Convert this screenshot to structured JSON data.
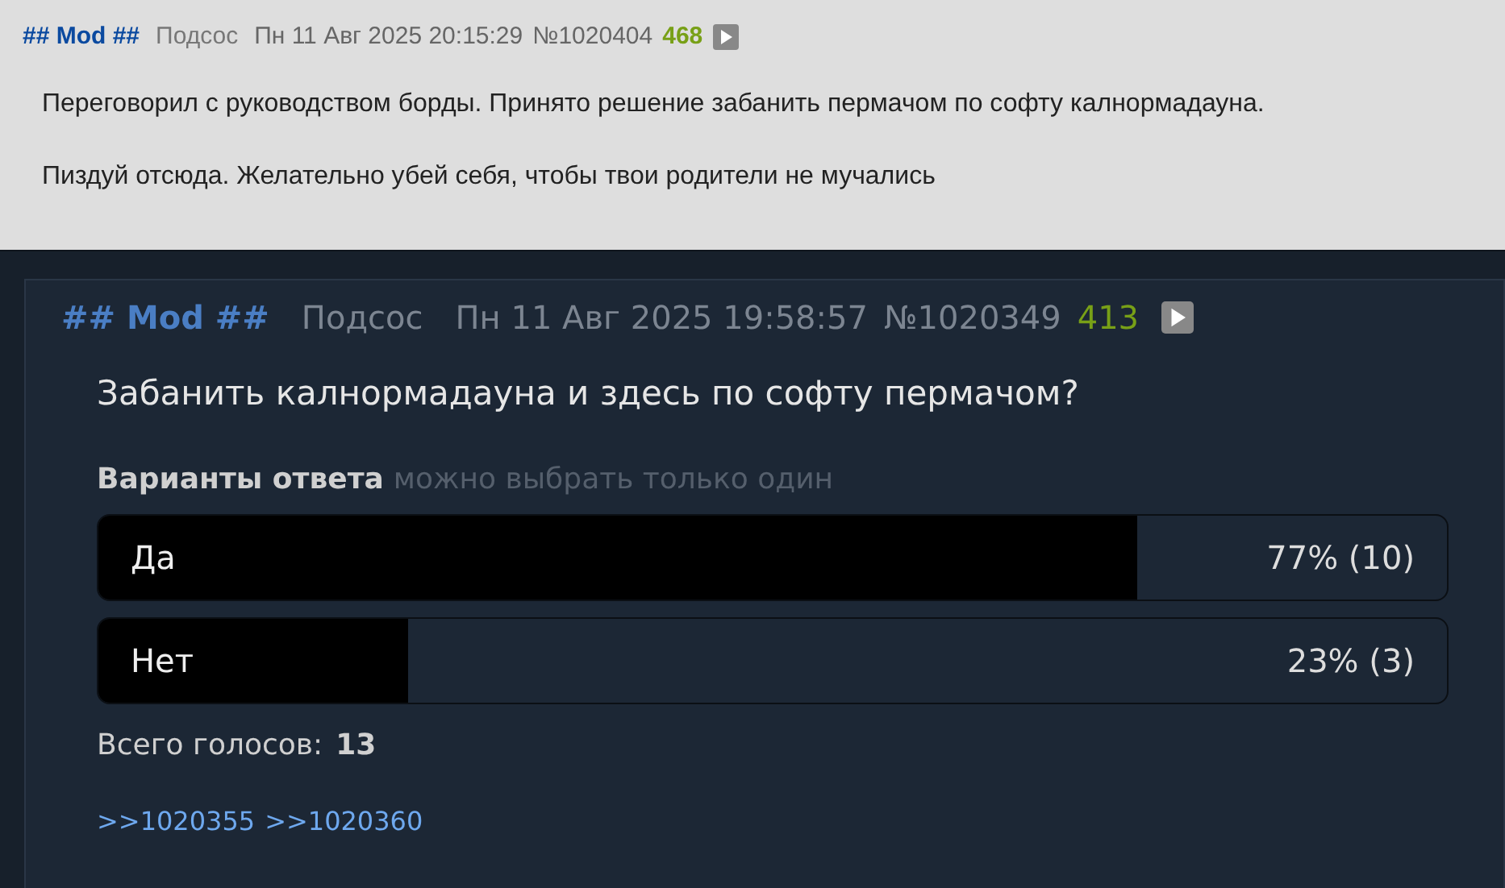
{
  "posts": [
    {
      "kind": "reply",
      "author": "## Mod ##",
      "name": "Подсос",
      "date": "Пн 11 Авг 2025 20:15:29",
      "number": "№1020404",
      "index": "468",
      "paragraphs": [
        "Переговорил с руководством борды. Принято решение забанить пермачом по софту калнормадауна.",
        "Пиздуй отсюда. Желательно убей себя, чтобы твои родители не мучались"
      ]
    },
    {
      "kind": "poll",
      "author": "## Mod ##",
      "name": "Подсос",
      "date": "Пн 11 Авг 2025 19:58:57",
      "number": "№1020349",
      "index": "413",
      "question": "Забанить калнормадауна и здесь по софту пермачом?",
      "options_label": "Варианты ответа",
      "options_hint": "можно выбрать только один",
      "options": [
        {
          "label": "Да",
          "result": "77% (10)",
          "level": 0.77
        },
        {
          "label": "Нет",
          "result": "23% (3)",
          "level": 0.23
        }
      ],
      "total_label": "Всего голосов:",
      "total": "13",
      "replies": [
        ">>1020355",
        ">>1020360"
      ]
    }
  ]
}
